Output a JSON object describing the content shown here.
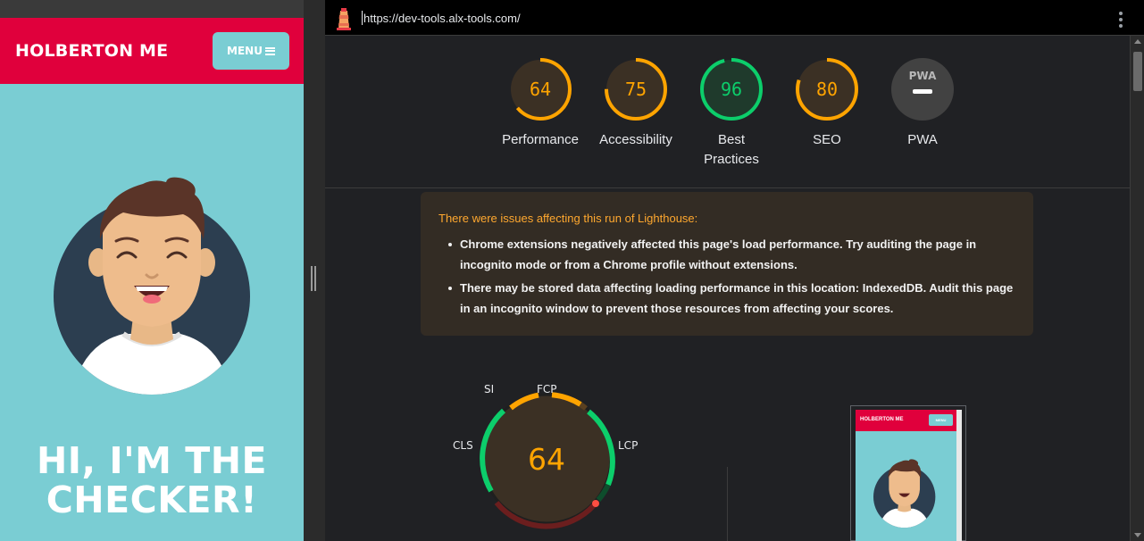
{
  "site": {
    "brand": "HOLBERTON ME",
    "menu_label": "MENU",
    "hero_line1": "HI, I'M THE",
    "hero_line2": "CHECKER!"
  },
  "devtools": {
    "url": "https://dev-tools.alx-tools.com/",
    "scores": [
      {
        "label": "Performance",
        "value": "64",
        "fraction": 0.64,
        "status": "average"
      },
      {
        "label": "Accessibility",
        "value": "75",
        "fraction": 0.75,
        "status": "average"
      },
      {
        "label": "Best Practices",
        "value": "96",
        "fraction": 0.96,
        "status": "pass"
      },
      {
        "label": "SEO",
        "value": "80",
        "fraction": 0.8,
        "status": "average"
      },
      {
        "label": "PWA",
        "value": "PWA",
        "fraction": 0,
        "status": "na"
      }
    ],
    "warning": {
      "title": "There were issues affecting this run of Lighthouse:",
      "items": [
        "Chrome extensions negatively affected this page's load performance. Try auditing the page in incognito mode or from a Chrome profile without extensions.",
        "There may be stored data affecting loading performance in this location: IndexedDB. Audit this page in an incognito window to prevent those resources from affecting your scores."
      ]
    },
    "metrics": {
      "score": "64",
      "labels": {
        "si": "SI",
        "fcp": "FCP",
        "lcp": "LCP",
        "cls": "CLS"
      }
    },
    "thumbnail": {
      "brand": "HOLBERTON ME",
      "menu": "MENU"
    }
  },
  "colors": {
    "site_header": "#e0003c",
    "site_bg": "#7acdd3",
    "pass": "#0cce6b",
    "average": "#ffa400",
    "fail": "#ff4e42"
  }
}
